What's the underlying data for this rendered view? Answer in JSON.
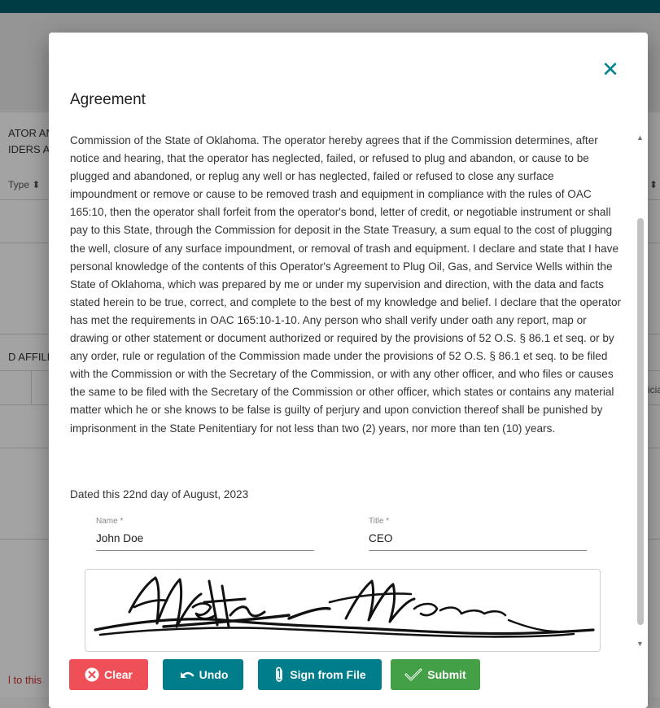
{
  "background": {
    "fragments": [
      "ATOR AN",
      "IDERS A",
      "Type ⬍",
      "⬍",
      "D AFFILI",
      "icia",
      "l to this"
    ]
  },
  "modal": {
    "title": "Agreement",
    "close_icon": "close-icon",
    "agreement_text": "Commission of the State of Oklahoma. The operator hereby agrees that if the Commission determines, after notice and hearing, that the operator has neglected, failed, or refused to plug and abandon, or cause to be plugged and abandoned, or replug any well or has neglected, failed or refused to close any surface impoundment or remove or cause to be removed trash and equipment in compliance with the rules of OAC 165:10, then the operator shall forfeit from the operator's bond, letter of credit, or negotiable instrument or shall pay to this State, through the Commission for deposit in the State Treasury, a sum equal to the cost of plugging the well, closure of any surface impoundment, or removal of trash and equipment. I declare and state that I have personal knowledge of the contents of this Operator's Agreement to Plug Oil, Gas, and Service Wells within the State of Oklahoma, which was prepared by me or under my supervision and direction, with the data and facts stated herein to be true, correct, and complete to the best of my knowledge and belief. I declare that the operator has met the requirements in OAC 165:10-1-10. Any person who shall verify under oath any report, map or drawing or other statement or document authorized or required by the provisions of 52 O.S. § 86.1 et seq. or by any order, rule or regulation of the Commission made under the provisions of 52 O.S. § 86.1 et seq. to be filed with the Commission or with the Secretary of the Commission, or with any other officer, and who files or causes the same to be filed with the Secretary of the Commission or other officer, which states or contains any material matter which he or she knows to be false is guilty of perjury and upon conviction thereof shall be punished by imprisonment in the State Penitentiary for not less than two (2) years, nor more than ten (10) years.",
    "dated": "Dated this 22nd day of August, 2023",
    "name_label": "Name *",
    "name_value": "John Doe",
    "title_label": "Title *",
    "title_value": "CEO",
    "signature": "handwritten signature"
  },
  "buttons": {
    "clear": "Clear",
    "undo": "Undo",
    "sign_from_file": "Sign from File",
    "submit": "Submit"
  },
  "colors": {
    "accent": "#00838f",
    "clear": "#ef4f57",
    "undo": "#007d8a",
    "sign_from_file": "#007d8a",
    "submit": "#43a047"
  }
}
